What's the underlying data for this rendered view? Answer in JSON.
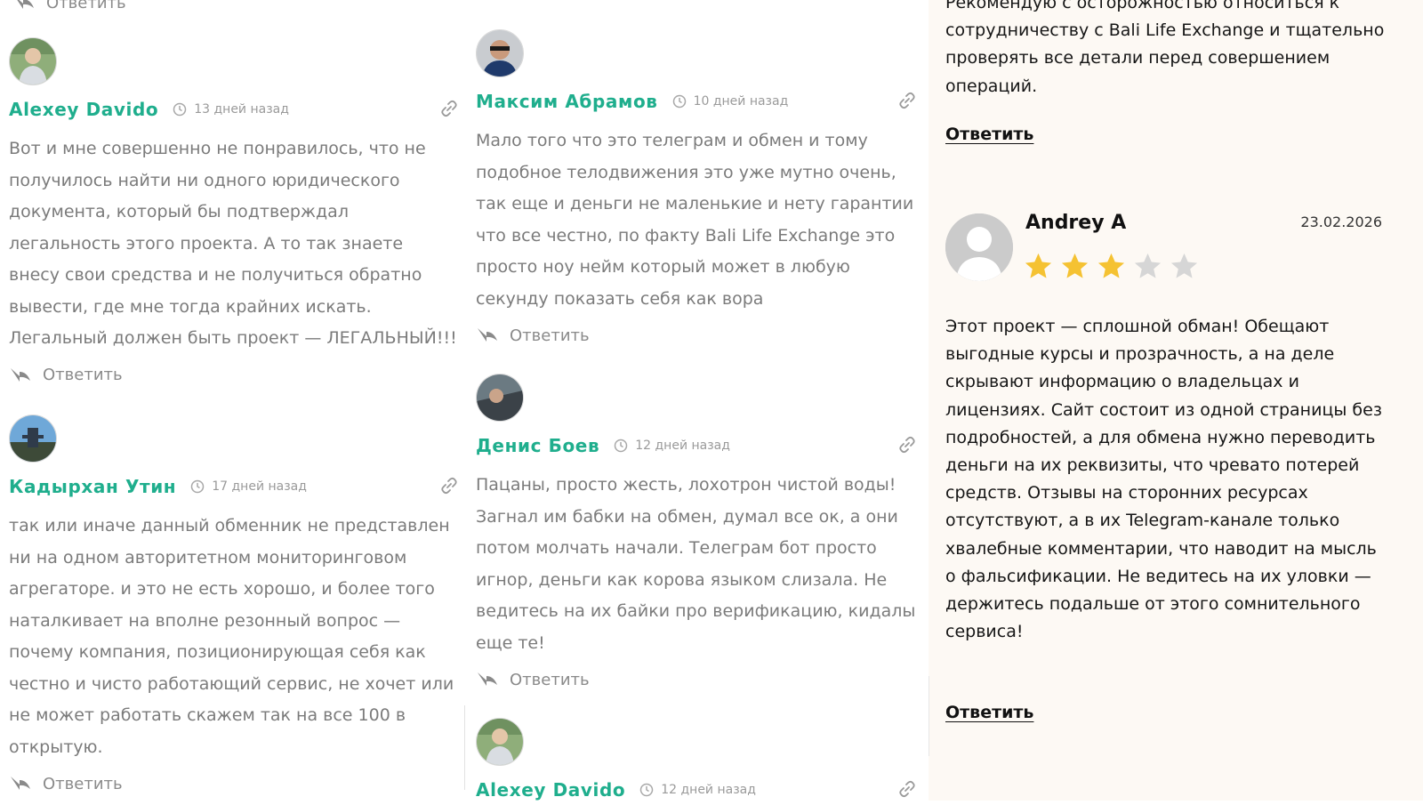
{
  "column1": [
    {
      "author": "Alexey Davido",
      "time": "13 дней назад",
      "text": "Вот и мне совершенно не понравилось, что не получилось найти ни одного юридического документа, который бы подтверждал легальность этого проекта. А то так знаете внесу свои средства и не получиться обратно вывести, где мне тогда крайних искать. Легальный должен быть проект — ЛЕГАЛЬНЫЙ!!!",
      "reply": "Ответить"
    },
    {
      "author": "Кадырхан Утин",
      "time": "17 дней назад",
      "text": "так или иначе данный обменник не представлен ни на одном авторитетном мониторинговом агрегаторе. и это не есть хорошо, и более того наталкивает на вполне резонный вопрос — почему компания, позиционирующая себя как честно и чисто работающий сервис, не хочет или не может работать скажем так на все 100 в открытую.",
      "reply": "Ответить"
    }
  ],
  "column2": [
    {
      "author": "Максим Абрамов",
      "time": "10 дней назад",
      "text": "Мало того что это телеграм и обмен и тому подобное телодвижения это уже мутно очень, так еще и деньги не маленькие и нету гарантии что все честно, по факту Bali Life Exchange это просто ноу нейм который может в любую секунду показать себя как вора",
      "reply": "Ответить"
    },
    {
      "author": "Денис Боев",
      "time": "12 дней назад",
      "text": "Пацаны, просто жесть, лохотрон чистой воды! Загнал им бабки на обмен, думал все ок, а они потом молчать начали. Телеграм бот просто игнор, деньги как корова языком слизала. Не ведитесь на их байки про верификацию, кидалы еще те!",
      "reply": "Ответить"
    },
    {
      "author": "Alexey Davido",
      "time": "12 дней назад"
    }
  ],
  "top_cut_reply": "Ответить",
  "right_panel": {
    "top_text": "Рекомендую с осторожностью относиться к сотрудничеству с Bali Life Exchange и тщательно проверять все детали перед совершением операций.",
    "top_reply": "Ответить",
    "review": {
      "name": "Andrey A",
      "date": "23.02.2026",
      "rating": 3,
      "rating_max": 5,
      "text": "Этот проект — сплошной обман! Обещают выгодные курсы и прозрачность, а на деле скрывают информацию о владельцах и лицензиях. Сайт состоит из одной страницы без подробностей, а для обмена нужно переводить деньги на их реквизиты, что чревато потерей средств. Отзывы на сторонних ресурсах отсутствуют, а в их Telegram-канале только хвалебные комментарии, что наводит на мысль о фальсификации. Не ведитесь на их уловки — держитесь подальше от этого сомнительного сервиса!",
      "reply": "Ответить"
    }
  },
  "colors": {
    "author": "#1fae8d",
    "star_filled": "#f5c232",
    "star_empty": "#d6d6d6",
    "panel_bg": "#fdf9f4"
  }
}
